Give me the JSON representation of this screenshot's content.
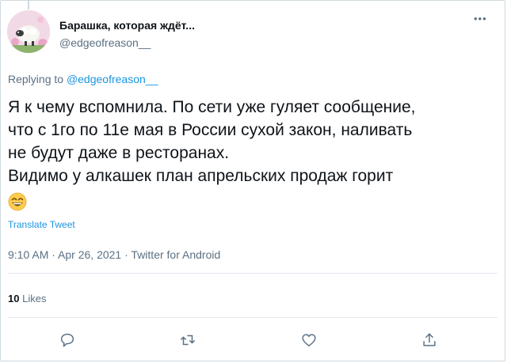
{
  "tweet": {
    "author_name": "Барашка, которая ждёт...",
    "author_handle": "@edgeofreason__",
    "replying_prefix": "Replying to",
    "replying_handle": "@edgeofreason__",
    "text_lines": [
      "Я к чему вспомнила. По сети уже гуляет сообщение,",
      "что с 1го по 11е мая в России сухой закон, наливать",
      "не будут даже в ресторанах.",
      "Видимо у алкашек план апрельских продаж горит"
    ],
    "emoji": "grinning-face-with-smiling-eyes",
    "translate_label": "Translate Tweet",
    "time": "9:10 AM",
    "date": "Apr 26, 2021",
    "source": "Twitter for Android",
    "likes_count": "10",
    "likes_label": "Likes"
  },
  "icons": {
    "more": "more-options-icon",
    "reply": "reply-icon",
    "retweet": "retweet-icon",
    "like": "like-icon",
    "share": "share-icon"
  },
  "colors": {
    "link": "#1b95e0",
    "secondary_text": "#5b7083",
    "primary_text": "#0f1419",
    "divider": "#e1e8ed"
  }
}
